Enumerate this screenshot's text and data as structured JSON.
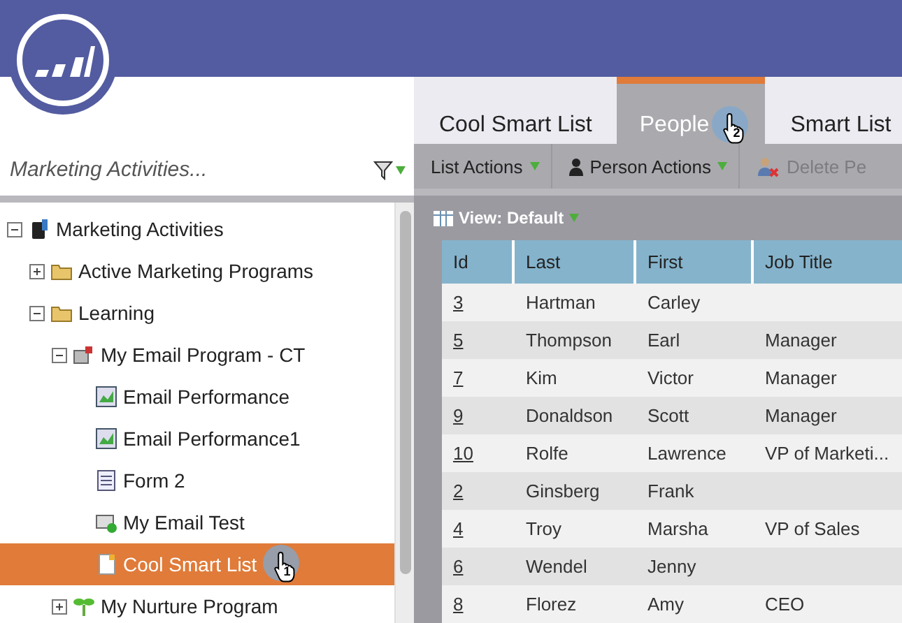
{
  "sidebar": {
    "title": "Marketing Activities...",
    "tree": [
      {
        "label": "Marketing Activities",
        "kind": "database",
        "expanded": true,
        "selected": false,
        "children": [
          {
            "label": "Active Marketing Programs",
            "kind": "folder",
            "expanded": false,
            "selected": false
          },
          {
            "label": "Learning",
            "kind": "folder",
            "expanded": true,
            "selected": false,
            "children": [
              {
                "label": "My Email Program - CT",
                "kind": "program",
                "expanded": true,
                "selected": false,
                "children": [
                  {
                    "label": "Email Performance",
                    "kind": "report",
                    "selected": false
                  },
                  {
                    "label": "Email Performance1",
                    "kind": "report",
                    "selected": false
                  },
                  {
                    "label": "Form 2",
                    "kind": "form",
                    "selected": false
                  },
                  {
                    "label": "My Email Test",
                    "kind": "test",
                    "selected": false
                  },
                  {
                    "label": "Cool Smart List",
                    "kind": "smartlist",
                    "selected": true,
                    "step": "1"
                  }
                ]
              },
              {
                "label": "My Nurture Program",
                "kind": "nurture",
                "expanded": false,
                "selected": false
              }
            ]
          }
        ]
      }
    ]
  },
  "tabs": [
    {
      "label": "Cool Smart List",
      "selected": false
    },
    {
      "label": "People",
      "selected": true,
      "step": "2"
    },
    {
      "label": "Smart List",
      "selected": false
    }
  ],
  "toolbar": [
    {
      "label": "List Actions",
      "kind": "menu",
      "disabled": false
    },
    {
      "label": "Person Actions",
      "kind": "person-menu",
      "disabled": false
    },
    {
      "label": "Delete Pe",
      "kind": "delete",
      "disabled": true
    }
  ],
  "view": {
    "label": "View: Default"
  },
  "table": {
    "columns": [
      "Id",
      "Last",
      "First",
      "Job Title"
    ],
    "rows": [
      [
        "3",
        "Hartman",
        "Carley",
        ""
      ],
      [
        "5",
        "Thompson",
        "Earl",
        "Manager"
      ],
      [
        "7",
        "Kim",
        "Victor",
        "Manager"
      ],
      [
        "9",
        "Donaldson",
        "Scott",
        "Manager"
      ],
      [
        "10",
        "Rolfe",
        "Lawrence",
        "VP of Marketi..."
      ],
      [
        "2",
        "Ginsberg",
        "Frank",
        ""
      ],
      [
        "4",
        "Troy",
        "Marsha",
        "VP of Sales"
      ],
      [
        "6",
        "Wendel",
        "Jenny",
        ""
      ],
      [
        "8",
        "Florez",
        "Amy",
        "CEO"
      ]
    ]
  }
}
